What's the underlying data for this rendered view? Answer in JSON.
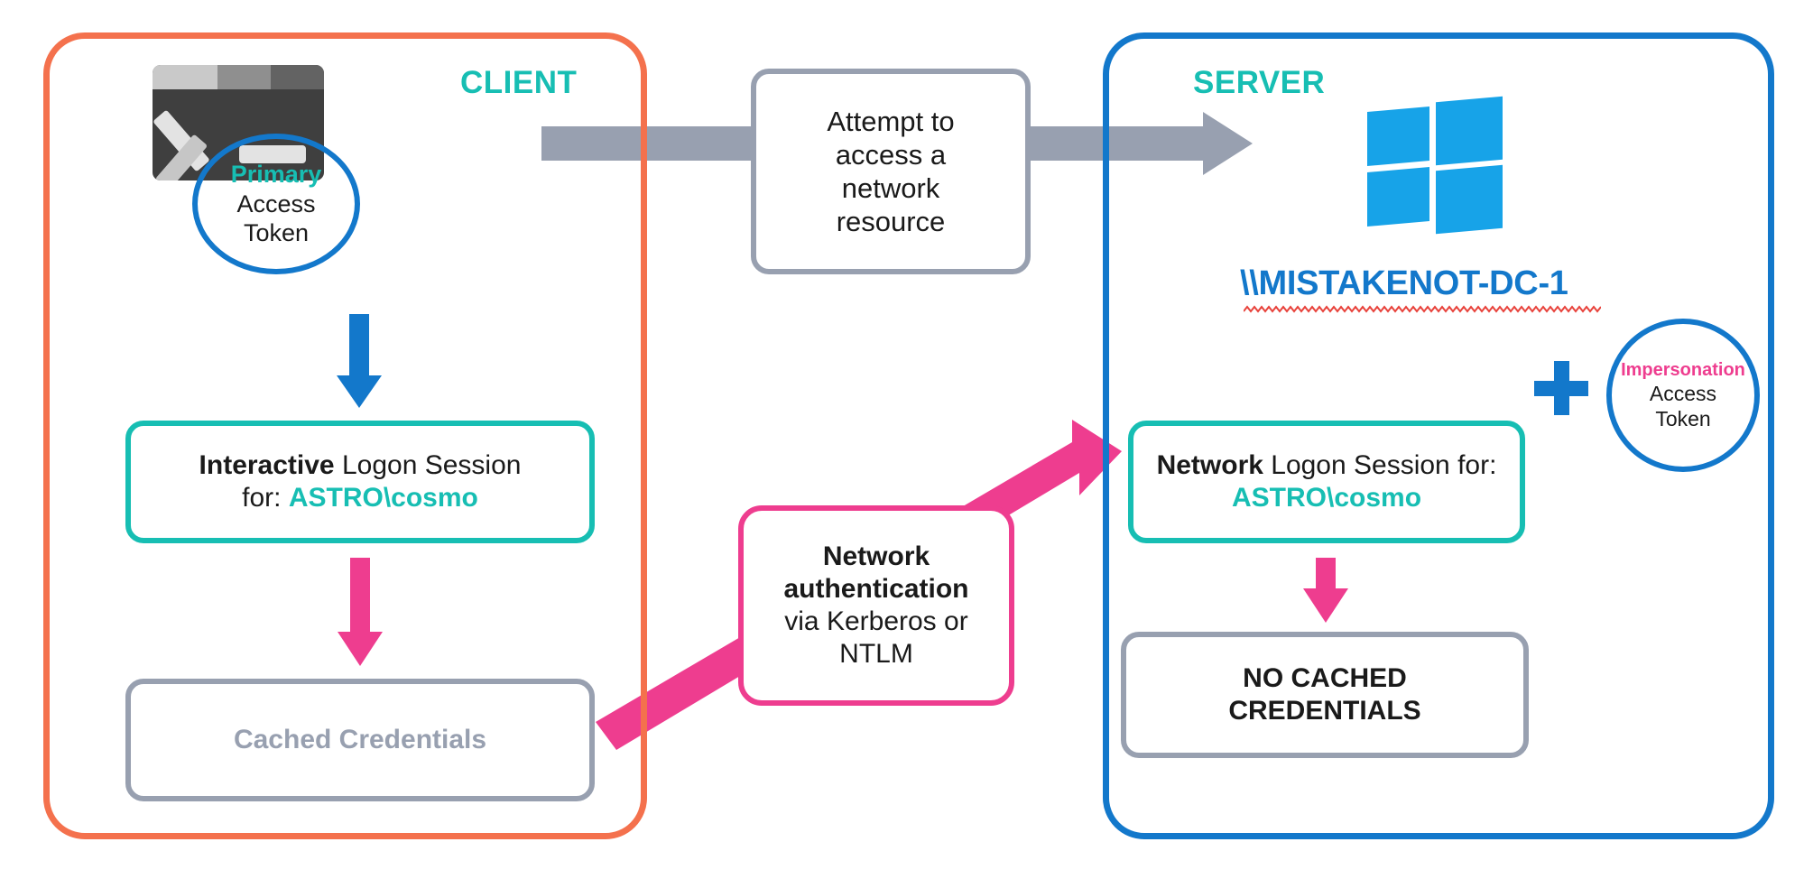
{
  "diagram": {
    "title": "Windows network authentication: client primary token vs server impersonation token",
    "colors": {
      "client_border": "#f4714d",
      "server_border": "#1378cb",
      "teal": "#17beb3",
      "pink": "#ee3d8f",
      "blue": "#1378cb",
      "gray": "#98a0b0",
      "windows_blue": "#17a3e8",
      "terminal_dark": "#3f3f3f",
      "spellcheck_red": "#e8433c"
    }
  },
  "client": {
    "title": "CLIENT",
    "terminal_icon": "powershell-terminal-icon",
    "primary_token": {
      "kind": "Primary",
      "line2": "Access",
      "line3": "Token"
    },
    "interactive_session": {
      "bold_prefix": "Interactive",
      "text": " Logon Session",
      "line2_label": "for: ",
      "line2_user": "ASTRO\\cosmo"
    },
    "cached_credentials": {
      "label": "Cached Credentials"
    }
  },
  "server": {
    "title": "SERVER",
    "windows_icon": "windows-logo-icon",
    "hostname": "\\\\MISTAKENOT-DC-1",
    "spellcheck_underline": true,
    "network_session": {
      "bold_prefix": "Network",
      "text": " Logon Session for:",
      "line2_user": "ASTRO\\cosmo"
    },
    "plus_symbol": "+",
    "impersonation_token": {
      "kind": "Impersonation",
      "line2": "Access",
      "line3": "Token"
    },
    "no_cached_credentials": {
      "line1": "NO CACHED",
      "line2": "CREDENTIALS"
    }
  },
  "callouts": {
    "attempt": {
      "line1": "Attempt to",
      "line2": "access a",
      "line3": "network",
      "line4": "resource"
    },
    "auth": {
      "bold_line1": "Network",
      "bold_line2": "authentication",
      "line3": "via Kerberos or",
      "line4": "NTLM"
    }
  },
  "arrows": [
    {
      "name": "client-to-server-request",
      "color": "#98a0b0",
      "direction": "right",
      "style": "block"
    },
    {
      "name": "token-to-interactive-session",
      "color": "#1378cb",
      "direction": "down",
      "style": "block"
    },
    {
      "name": "interactive-to-cached-credentials",
      "color": "#ee3d8f",
      "direction": "down",
      "style": "block"
    },
    {
      "name": "cached-credentials-to-network-session",
      "color": "#ee3d8f",
      "direction": "up-right",
      "style": "diagonal"
    },
    {
      "name": "network-session-to-no-cached",
      "color": "#ee3d8f",
      "direction": "down",
      "style": "block"
    }
  ]
}
